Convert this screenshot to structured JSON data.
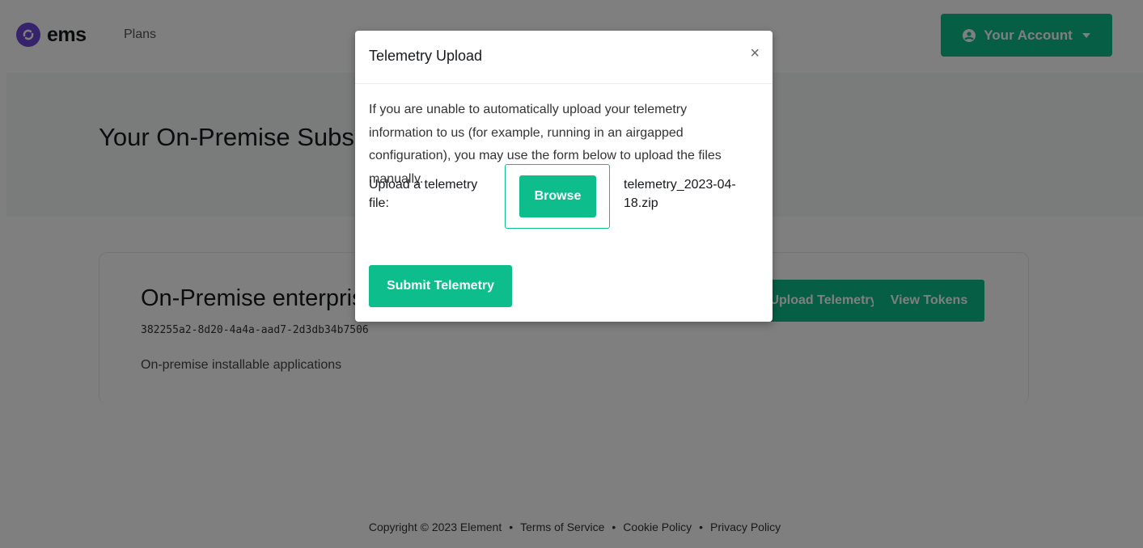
{
  "nav": {
    "brand": "ems",
    "plans_label": "Plans",
    "account_label": "Your Account"
  },
  "hero": {
    "title": "Your On-Premise Subscriptions"
  },
  "card": {
    "title": "On-Premise enterprise",
    "id": "382255a2-8d20-4a4a-aad7-2d3db34b7506",
    "description": "On-premise installable applications",
    "upload_telemetry_label": "Upload Telemetry",
    "view_tokens_label": "View Tokens"
  },
  "footer": {
    "copyright": "Copyright © 2023 Element",
    "terms": "Terms of Service",
    "cookie": "Cookie Policy",
    "privacy": "Privacy Policy"
  },
  "modal": {
    "title": "Telemetry Upload",
    "close": "×",
    "text": "If you are unable to automatically upload your telemetry information to us (for example, running in an airgapped configuration), you may use the form below to upload the files manually.",
    "upload_label": "Upload a telemetry file:",
    "browse_label": "Browse",
    "file_name": "telemetry_2023-04-18.zip",
    "submit_label": "Submit Telemetry"
  },
  "colors": {
    "accent": "#0dbd8b",
    "brand": "#6f45d8"
  },
  "icons": {
    "logo": "ems-logo-icon",
    "account": "user-circle-icon",
    "caret": "caret-down-icon"
  }
}
